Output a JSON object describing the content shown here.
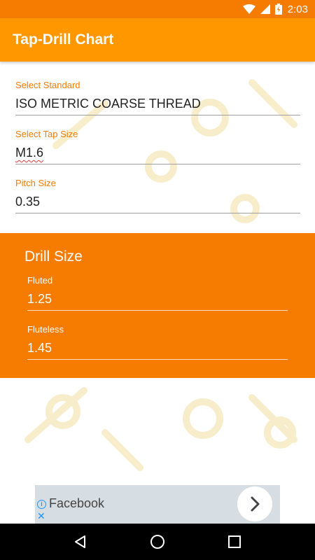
{
  "status_bar": {
    "time": "2:03"
  },
  "app_bar": {
    "title": "Tap-Drill Chart"
  },
  "form": {
    "standard": {
      "label": "Select Standard",
      "value": "ISO METRIC COARSE THREAD"
    },
    "tap_size": {
      "label": "Select Tap Size",
      "value": "M1.6"
    },
    "pitch": {
      "label": "Pitch Size",
      "value": "0.35"
    }
  },
  "drill_size": {
    "title": "Drill Size",
    "fluted": {
      "label": "Fluted",
      "value": "1.25"
    },
    "fluteless": {
      "label": "Fluteless",
      "value": "1.45"
    }
  },
  "ad": {
    "text": "Facebook"
  },
  "colors": {
    "status_bar": "#f57c00",
    "app_bar": "#ff9800",
    "accent": "#f57c00",
    "panel": "#f57c00",
    "nav_bar": "#000000"
  },
  "icons": [
    "wifi-icon",
    "signal-icon",
    "battery-icon",
    "info-icon",
    "close-icon",
    "chevron-right-icon",
    "back-icon",
    "home-icon",
    "recents-icon"
  ]
}
